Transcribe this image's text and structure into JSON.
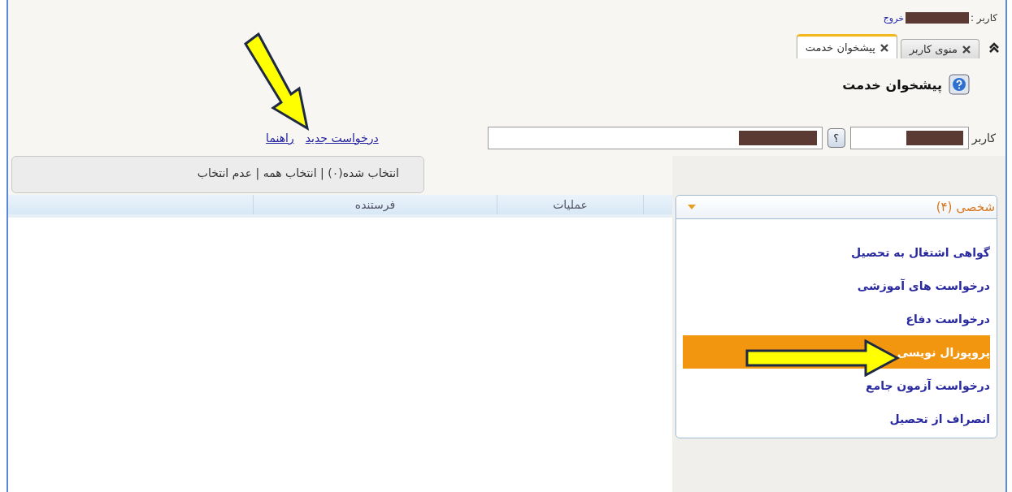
{
  "user_bar": {
    "label": "کاربر :",
    "logout_link": "خروج"
  },
  "tabs": [
    {
      "label": "منوی کاربر",
      "selected": false
    },
    {
      "label": "پیشخوان خدمت",
      "selected": true
    }
  ],
  "page_title": "پیشخوان خدمت",
  "form": {
    "label": "کاربر",
    "lookup_button": "؟"
  },
  "links": [
    "درخواست جدید",
    "راهنما"
  ],
  "selection_bar": "انتخاب شده(۰) | انتخاب همه | عدم انتخاب",
  "table": {
    "columns": [
      "عملیات",
      "فرستنده"
    ]
  },
  "sidebar": {
    "title": "شخصی (۴)",
    "expanded": true,
    "items": [
      {
        "label": "گواهی اشتغال به تحصیل",
        "selected": false
      },
      {
        "label": "درخواست های آموزشی",
        "selected": false
      },
      {
        "label": "درخواست دفاع",
        "selected": false
      },
      {
        "label": "پروپوزال نویسی",
        "selected": true
      },
      {
        "label": "درخواست آزمون جامع",
        "selected": false
      },
      {
        "label": "انصراف از تحصیل",
        "selected": false
      }
    ]
  }
}
